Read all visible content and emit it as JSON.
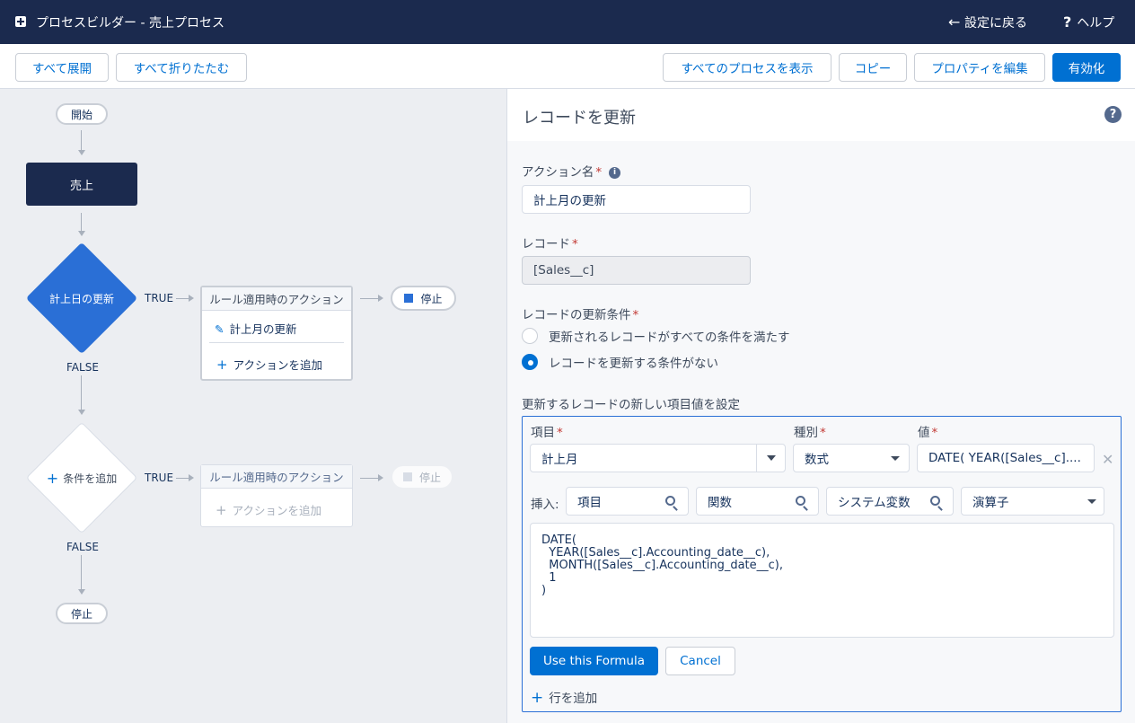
{
  "header": {
    "title": "プロセスビルダー - 売上プロセス",
    "back_label": "設定に戻る",
    "help_label": "ヘルプ"
  },
  "toolbar": {
    "expand_all": "すべて展開",
    "collapse_all": "すべて折りたたむ",
    "view_all_processes": "すべてのプロセスを表示",
    "copy": "コピー",
    "edit_properties": "プロパティを編集",
    "activate": "有効化"
  },
  "canvas": {
    "start_label": "開始",
    "object_label": "売上",
    "criteria1_label": "計上日の更新",
    "true_label": "TRUE",
    "false_label": "FALSE",
    "actions_header": "ルール適用時のアクション",
    "action1_label": "計上月の更新",
    "add_action_label": "アクションを追加",
    "stop_label": "停止",
    "add_criteria_label": "条件を追加"
  },
  "panel": {
    "title": "レコードを更新",
    "action_name_label": "アクション名",
    "action_name_value": "計上月の更新",
    "record_label": "レコード",
    "record_value": "[Sales__c]",
    "criteria_label": "レコードの更新条件",
    "radio_all_conditions": "更新されるレコードがすべての条件を満たす",
    "radio_no_criteria": "レコードを更新する条件がない",
    "set_values_label": "更新するレコードの新しい項目値を設定",
    "col_field": "項目",
    "col_type": "種別",
    "col_value": "値",
    "field_value": "計上月",
    "type_value": "数式",
    "value_value": "DATE( YEAR([Sales__c]....",
    "insert_label": "挿入:",
    "insert_field": "項目",
    "insert_function": "関数",
    "insert_sysvar": "システム変数",
    "insert_operator": "演算子",
    "formula": "DATE(\n  YEAR([Sales__c].Accounting_date__c),\n  MONTH([Sales__c].Accounting_date__c),\n  1\n)",
    "use_formula": "Use this Formula",
    "cancel": "Cancel",
    "add_row": "行を追加"
  },
  "colors": {
    "header_bg": "#1b2a4e",
    "brand": "#0070d2",
    "criteria_blue": "#2a6fd6",
    "required": "#c23934"
  }
}
